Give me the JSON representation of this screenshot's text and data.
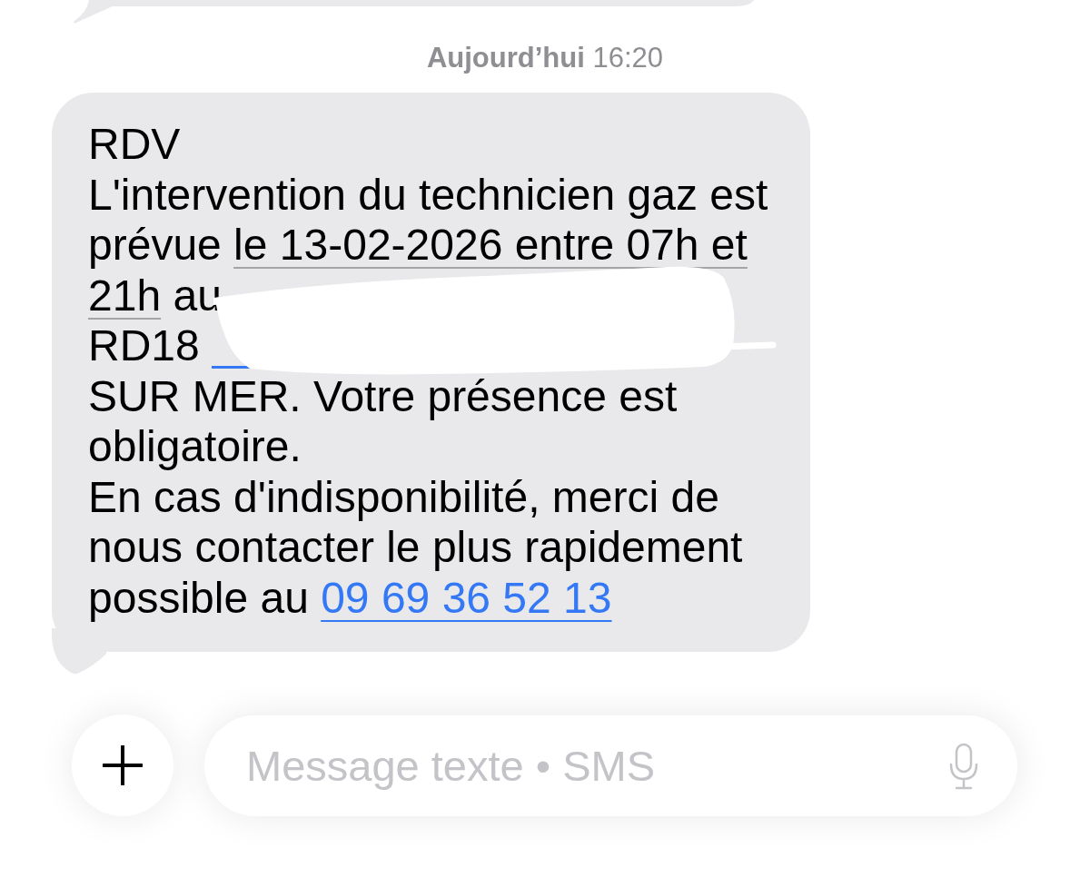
{
  "timestamp": "**Aujourd’hui** 16:20",
  "message": {
    "redacted": true,
    "lines": [
      [
        {
          "kind": "text",
          "text": "RDV"
        }
      ],
      [
        {
          "kind": "text",
          "text": "L'intervention du technicien gaz est"
        }
      ],
      [
        {
          "kind": "text",
          "text": "prévue "
        },
        {
          "kind": "date_link",
          "text": "le 13-02-2026 entre 07h et"
        }
      ],
      [
        {
          "kind": "date_link",
          "text": "21h"
        },
        {
          "kind": "text",
          "text": " au"
        }
      ],
      [
        {
          "kind": "text",
          "text": "RD18 "
        },
        {
          "kind": "redacted_link"
        }
      ],
      [
        {
          "kind": "text",
          "text": "SUR MER. Votre présence est"
        }
      ],
      [
        {
          "kind": "text",
          "text": "obligatoire."
        }
      ],
      [
        {
          "kind": "text",
          "text": "En cas d'indisponibilité, merci de"
        }
      ],
      [
        {
          "kind": "text",
          "text": "nous contacter le plus rapidement"
        }
      ],
      [
        {
          "kind": "text",
          "text": "possible au "
        },
        {
          "kind": "phone_link",
          "text": "09 69 36 52 13"
        }
      ]
    ]
  },
  "composer": {
    "placeholder": "Message texte • SMS"
  }
}
